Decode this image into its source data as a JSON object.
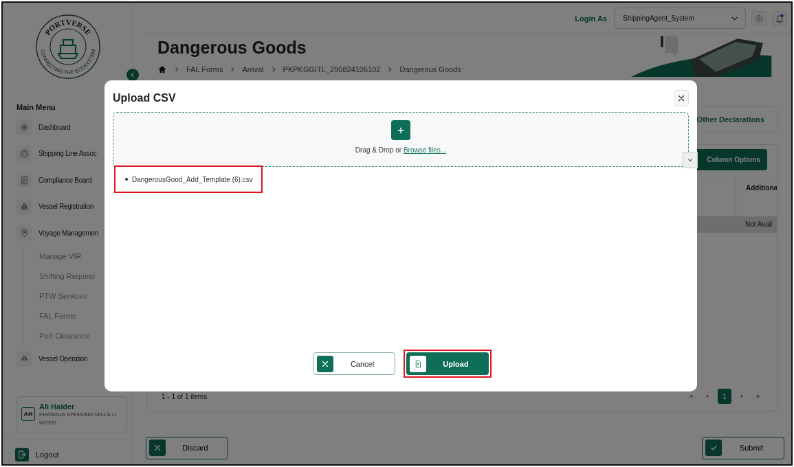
{
  "sidebar": {
    "logo": {
      "name": "PORTVERSE",
      "tagline": "CONNECTING THE ECOSYSTEM"
    },
    "menu_title": "Main Menu",
    "menu": [
      {
        "label": "Dashboard"
      },
      {
        "label": "Shipping Line Assoc"
      },
      {
        "label": "Compliance Board"
      },
      {
        "label": "Vessel Registration"
      },
      {
        "label": "Voyage Managemen",
        "children": [
          {
            "label": "Manage VIR"
          },
          {
            "label": "Shifting Request"
          },
          {
            "label": "PTW Services"
          },
          {
            "label": "FAL Forms"
          },
          {
            "label": "Port Clearance"
          }
        ]
      },
      {
        "label": "Vessel Operation"
      }
    ],
    "user": {
      "initials": "AH",
      "name": "Ali Haider",
      "org": "KHAWAJA SPINNING MILLS LIMITED"
    },
    "logout": "Logout"
  },
  "header": {
    "login_label": "Login As",
    "role": "ShippingAgent_System",
    "notification": true
  },
  "page": {
    "title": "Dangerous Goods",
    "breadcrumb": [
      "FAL Forms",
      "Arrival",
      "PKPKGGITL_290824105102",
      "Dangerous Goods"
    ]
  },
  "tabs": [
    {
      "label": "Other Declarations",
      "selected": false
    }
  ],
  "toolbar": {
    "column_options": "Column Options"
  },
  "table": {
    "columns": [
      "Additiona"
    ],
    "rows": [
      {
        "cells": [
          "Not Avail"
        ],
        "selected": true
      }
    ]
  },
  "pagination": {
    "summary": "1 - 1 of 1 items",
    "pages": [
      {
        "label": "1",
        "selected": true
      }
    ]
  },
  "footer_buttons": [
    {
      "label": "Discard",
      "kind": "discard"
    },
    {
      "label": "Submit",
      "kind": "submit"
    }
  ],
  "dialog": {
    "title": "Upload CSV",
    "dropzone": {
      "text": "Drag & Drop or",
      "link": "Browse files..."
    },
    "files": [
      {
        "name": "DangerousGood_Add_Template (6).csv",
        "highlighted": true
      }
    ],
    "buttons": [
      {
        "label": "Cancel",
        "kind": "cancel",
        "highlighted": false
      },
      {
        "label": "Upload",
        "kind": "upload",
        "highlighted": true
      }
    ]
  }
}
